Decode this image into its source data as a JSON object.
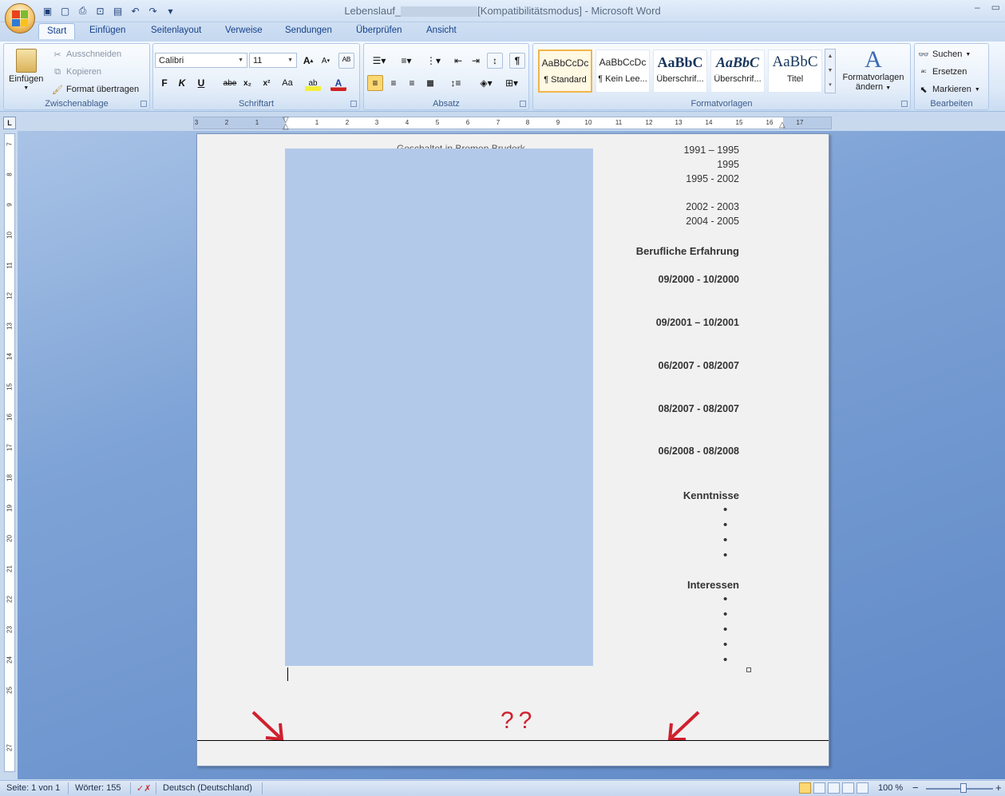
{
  "window": {
    "title_prefix": "Lebenslauf_",
    "title_suffix": "[Kompatibilitätsmodus] - Microsoft Word",
    "minimize": "–",
    "maximize": "▭",
    "close": "✕"
  },
  "quick_access": {
    "icons": [
      "save-icon",
      "new-icon",
      "print-icon",
      "print-preview-icon",
      "blank-icon",
      "undo-icon",
      "redo-icon",
      "customize-icon"
    ],
    "glyphs": [
      "▣",
      "▢",
      "⎙",
      "🔍",
      "▤",
      "↶",
      "↷",
      "▾"
    ]
  },
  "tabs": [
    "Start",
    "Einfügen",
    "Seitenlayout",
    "Verweise",
    "Sendungen",
    "Überprüfen",
    "Ansicht"
  ],
  "ribbon": {
    "clipboard": {
      "label": "Zwischenablage",
      "paste": "Einfügen",
      "cut": "Ausschneiden",
      "copy": "Kopieren",
      "format_painter": "Format übertragen"
    },
    "font": {
      "label": "Schriftart",
      "font_name": "Calibri",
      "font_size": "11",
      "bold": "F",
      "italic": "K",
      "underline": "U",
      "strike": "abe",
      "subscript": "x₂",
      "superscript": "x²",
      "change_case": "Aa",
      "highlight": "ab",
      "font_color": "A",
      "grow": "A",
      "shrink": "A"
    },
    "paragraph": {
      "label": "Absatz"
    },
    "styles": {
      "label": "Formatvorlagen",
      "tiles": [
        {
          "sample": "AaBbCcDc",
          "name": "¶ Standard"
        },
        {
          "sample": "AaBbCcDc",
          "name": "¶ Kein Lee..."
        },
        {
          "sample": "AaBbC",
          "name": "Überschrif..."
        },
        {
          "sample": "AaBbC",
          "name": "Überschrif..."
        },
        {
          "sample": "AaBbC",
          "name": "Titel"
        }
      ],
      "change_styles_line1": "Formatvorlagen",
      "change_styles_line2": "ändern"
    },
    "editing": {
      "label": "Bearbeiten",
      "find": "Suchen",
      "replace": "Ersetzen",
      "select": "Markieren"
    }
  },
  "ruler": {
    "h_numbers": [
      "3",
      "2",
      "1",
      "1",
      "2",
      "3",
      "4",
      "5",
      "6",
      "7",
      "8",
      "9",
      "10",
      "11",
      "12",
      "13",
      "14",
      "15",
      "16",
      "17"
    ],
    "v_numbers": [
      "7",
      "8",
      "9",
      "10",
      "11",
      "12",
      "13",
      "14",
      "15",
      "16",
      "17",
      "18",
      "19",
      "20",
      "21",
      "22",
      "23",
      "24",
      "25",
      "27"
    ],
    "corner": "L"
  },
  "document": {
    "hidden_text": "Geschaltet in Bremen Bruderk",
    "dates_top": [
      "1991 – 1995",
      "1995",
      "1995 - 2002",
      "2002 - 2003",
      "2004 - 2005"
    ],
    "section_experience": "Berufliche Erfahrung",
    "experience_dates": [
      "09/2000 - 10/2000",
      "09/2001 – 10/2001",
      "06/2007 - 08/2007",
      "08/2007 - 08/2007",
      "06/2008 - 08/2008"
    ],
    "section_skills": "Kenntnisse",
    "section_interests": "Interessen",
    "bullet": "•",
    "question_marks": "??"
  },
  "status": {
    "page": "Seite: 1 von 1",
    "words": "Wörter: 155",
    "language": "Deutsch (Deutschland)",
    "zoom": "100 %",
    "zoom_minus": "−",
    "zoom_plus": "+"
  },
  "colors": {
    "accent_red": "#d0202e",
    "textbox_fill": "#b2c9ea"
  }
}
